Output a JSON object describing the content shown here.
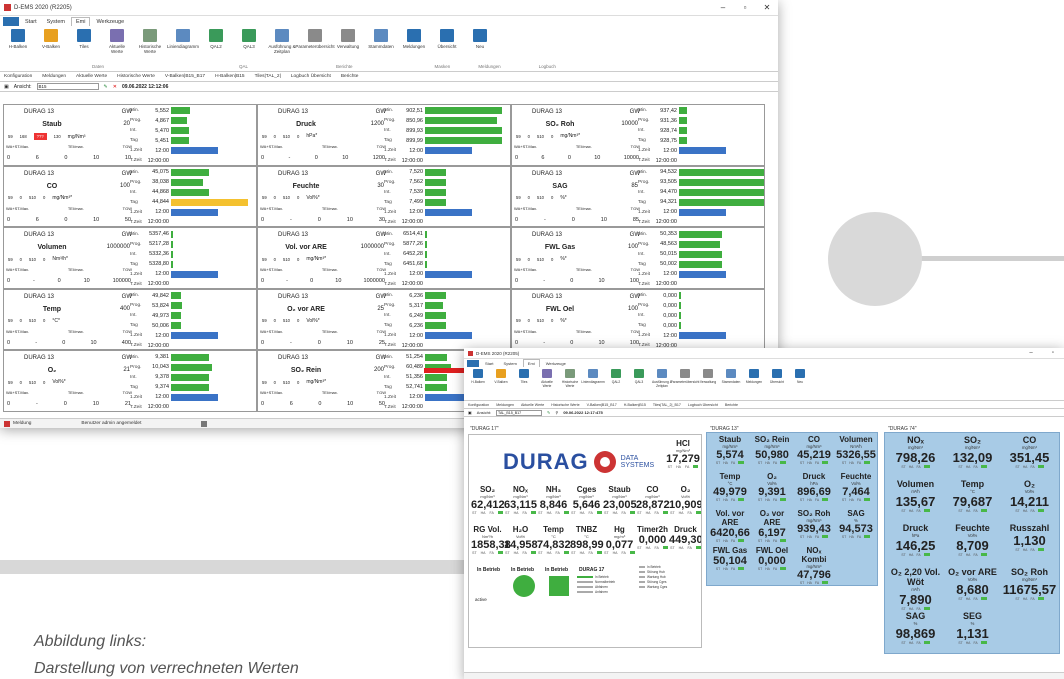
{
  "caption": {
    "line1": "Abbildung links:",
    "line2": "Darstellung von verrechneten Werten"
  },
  "colors": {
    "accent": "#2a6fb0",
    "bar_green": "#3fae3f",
    "bar_blue": "#3a73c6",
    "bar_yellow": "#f4c12f",
    "alarm_red": "#e33333",
    "tile_blue": "#a8cbe6",
    "arrow_red": "#e02020"
  },
  "w1": {
    "title": "D-EMS 2020 (R2205)",
    "menu": [
      "Start",
      "System",
      "Emi",
      "Werkzeuge"
    ],
    "menu_file": "",
    "ribbon": [
      {
        "label": "H-Balken",
        "icon": "h-bars-icon",
        "color": "#2a6fb0"
      },
      {
        "label": "V-Balken",
        "icon": "v-bars-icon",
        "color": "#e8a020"
      },
      {
        "label": "Tiles",
        "icon": "tiles-icon",
        "color": "#2a6fb0"
      },
      {
        "label": "Aktuelle Werte",
        "icon": "current-values-icon",
        "color": "#7a6fb0"
      },
      {
        "label": "Historische Werte",
        "icon": "historic-values-icon",
        "color": "#7a9a7a"
      },
      {
        "label": "Liniendiagramm",
        "icon": "line-chart-icon",
        "color": "#5c8ac0"
      },
      {
        "label": "QAL2",
        "icon": "qal2-icon",
        "color": "#3a9a5a"
      },
      {
        "label": "QAL3",
        "icon": "qal3-icon",
        "color": "#3a9a5a"
      },
      {
        "label": "Ausführung & Zeitplan",
        "icon": "schedule-icon",
        "color": "#5c8ac0"
      },
      {
        "label": "Parameterübersicht",
        "icon": "parameter-icon",
        "color": "#8a8a8a"
      },
      {
        "label": "Verwaltung",
        "icon": "admin-icon",
        "color": "#8a8a8a"
      },
      {
        "label": "Stammdaten",
        "icon": "master-data-icon",
        "color": "#5c8ac0"
      },
      {
        "label": "Meldungen",
        "icon": "globe-icon",
        "color": "#2a6fb0"
      },
      {
        "label": "Übersicht",
        "icon": "save-icon",
        "color": "#2a6fb0"
      },
      {
        "label": "Neu",
        "icon": "new-icon",
        "color": "#2a6fb0"
      }
    ],
    "groups": [
      "Daten",
      "QAL",
      "Berichte",
      "Masken",
      "Meldungen",
      "Logbuch"
    ],
    "tabs": [
      "Konfiguration",
      "Meldungen",
      "Aktuelle Werte",
      "Historische Werte",
      "V-Balken|B15_B17",
      "H-Balken|B15",
      "Tiles|TAL_2|",
      "Logbuch Übersicht",
      "Berichte"
    ],
    "view_label": "Ansicht:",
    "view_value": "B15",
    "timestamp": "09.06.2022 12:12:06",
    "status_left": "Meldung",
    "status_mid": "Benutzer admin angemeldet",
    "row_keys": [
      "Min.",
      "Prog.",
      "Int.",
      "Tag",
      "1.Zeit",
      "T.Zeit"
    ],
    "cells": [
      {
        "device": "DURAG 13",
        "gw_label": "GW",
        "name": "Staub",
        "gw": "20",
        "r3": [
          "59",
          "168",
          "???",
          "130",
          "mg/Nm³"
        ],
        "alarm": true,
        "r4": [
          "WA+ST.Max.",
          "TEI/max.",
          "TGW"
        ],
        "r5": [
          "0",
          "6",
          "0",
          "10",
          "10"
        ],
        "rvals": [
          "5,552",
          "4,867",
          "5,470",
          "5,451",
          "12:00",
          "12:00:00"
        ],
        "fills": [
          0.22,
          0.19,
          0.21,
          0.21,
          0,
          0
        ],
        "types": [
          "g",
          "g",
          "g",
          "g",
          "b",
          ""
        ]
      },
      {
        "device": "DURAG 13",
        "gw_label": "GW",
        "name": "Druck",
        "gw": "1200",
        "r3": [
          "59",
          "0",
          "510",
          "0",
          "hPa*"
        ],
        "alarm": false,
        "r4": [
          "WA+ST.Max.",
          "TEI/max.",
          "TGW"
        ],
        "r5": [
          "0",
          "-",
          "0",
          "10",
          "1200"
        ],
        "rvals": [
          "902,51",
          "850,96",
          "899,93",
          "899,99",
          "12:00",
          "12:00:00"
        ],
        "fills": [
          0.9,
          0.85,
          0.9,
          0.9,
          0,
          0
        ],
        "types": [
          "g",
          "g",
          "g",
          "g",
          "b",
          ""
        ]
      },
      {
        "device": "DURAG 13",
        "gw_label": "GW",
        "name": "SO₂ Roh",
        "gw": "10000",
        "r3": [
          "59",
          "0",
          "510",
          "0",
          "mg/Nm³*"
        ],
        "alarm": false,
        "r4": [
          "WA+ST.Max.",
          "TEI/max.",
          "TGW"
        ],
        "r5": [
          "0",
          "6",
          "0",
          "10",
          "10000"
        ],
        "rvals": [
          "937,42",
          "931,36",
          "928,74",
          "928,75",
          "12:00",
          "12:00:00"
        ],
        "fills": [
          0.09,
          0.09,
          0.09,
          0.09,
          0,
          0
        ],
        "types": [
          "g",
          "g",
          "g",
          "g",
          "b",
          ""
        ]
      },
      {
        "device": "DURAG 13",
        "gw_label": "GW",
        "name": "CO",
        "gw": "100",
        "r3": [
          "59",
          "0",
          "510",
          "0",
          "mg/Nm³*"
        ],
        "alarm": false,
        "r4": [
          "WA+ST.Max.",
          "TEI/max.",
          "TGW"
        ],
        "r5": [
          "0",
          "6",
          "0",
          "10",
          "50"
        ],
        "rvals": [
          "45,075",
          "38,038",
          "44,868",
          "44,844",
          "12:00",
          "12:00:00"
        ],
        "fills": [
          0.45,
          0.38,
          0.45,
          0.9,
          0,
          0
        ],
        "types": [
          "g",
          "g",
          "g",
          "y",
          "b",
          ""
        ]
      },
      {
        "device": "DURAG 13",
        "gw_label": "GW",
        "name": "Feuchte",
        "gw": "30",
        "r3": [
          "59",
          "0",
          "510",
          "0",
          "Vol%*"
        ],
        "alarm": false,
        "r4": [
          "WA+ST.Max.",
          "TEI/max.",
          "TGW"
        ],
        "r5": [
          "0",
          "-",
          "0",
          "10",
          "30"
        ],
        "rvals": [
          "7,520",
          "7,562",
          "7,539",
          "7,499",
          "12:00",
          "12:00:00"
        ],
        "fills": [
          0.25,
          0.25,
          0.25,
          0.25,
          0,
          0
        ],
        "types": [
          "g",
          "g",
          "g",
          "g",
          "b",
          ""
        ]
      },
      {
        "device": "DURAG 13",
        "gw_label": "GW",
        "name": "SAG",
        "gw": "85",
        "r3": [
          "59",
          "0",
          "510",
          "0",
          "%*"
        ],
        "alarm": false,
        "r4": [
          "WA+ST.Max.",
          "TEI/max.",
          "TGW"
        ],
        "r5": [
          "0",
          "-",
          "0",
          "10",
          "85"
        ],
        "rvals": [
          "94,532",
          "93,505",
          "94,470",
          "94,321",
          "12:00",
          "12:00:00"
        ],
        "fills": [
          1,
          1,
          1,
          1,
          0,
          0
        ],
        "types": [
          "g",
          "g",
          "g",
          "g",
          "b",
          ""
        ]
      },
      {
        "device": "DURAG 13",
        "gw_label": "GW",
        "name": "Volumen",
        "gw": "1000000",
        "r3": [
          "59",
          "0",
          "510",
          "0",
          "Nm³/h*"
        ],
        "alarm": false,
        "r4": [
          "WA+ST.Max.",
          "TEI/max.",
          "TGW"
        ],
        "r5": [
          "0",
          "-",
          "0",
          "10",
          "100000"
        ],
        "rvals": [
          "5357,46",
          "5217,28",
          "5332,36",
          "5328,80",
          "12:00",
          "12:00:00"
        ],
        "fills": [
          0.02,
          0.02,
          0.02,
          0.02,
          0,
          0
        ],
        "types": [
          "g",
          "g",
          "g",
          "g",
          "b",
          ""
        ]
      },
      {
        "device": "DURAG 13",
        "gw_label": "GW",
        "name": "Vol. vor ARE",
        "gw": "1000000",
        "r3": [
          "59",
          "0",
          "510",
          "0",
          "mg/Nm³*"
        ],
        "alarm": false,
        "r4": [
          "WA+ST.Max.",
          "TEI/max.",
          "TGW"
        ],
        "r5": [
          "0",
          "-",
          "0",
          "10",
          "1000000"
        ],
        "rvals": [
          "6514,41",
          "5877,26",
          "6452,28",
          "6451,68",
          "12:00",
          "12:00:00"
        ],
        "fills": [
          0,
          0,
          0,
          0,
          0,
          0
        ],
        "types": [
          "g",
          "g",
          "g",
          "g",
          "b",
          ""
        ]
      },
      {
        "device": "DURAG 13",
        "gw_label": "GW",
        "name": "FWL Gas",
        "gw": "100",
        "r3": [
          "59",
          "0",
          "510",
          "0",
          "%*"
        ],
        "alarm": false,
        "r4": [
          "WA+ST.Max.",
          "TEI/max.",
          "TGW"
        ],
        "r5": [
          "0",
          "-",
          "0",
          "10",
          "100"
        ],
        "rvals": [
          "50,353",
          "48,563",
          "50,015",
          "50,002",
          "12:00",
          "12:00:00"
        ],
        "fills": [
          0.5,
          0.48,
          0.5,
          0.5,
          0,
          0
        ],
        "types": [
          "g",
          "g",
          "g",
          "g",
          "b",
          ""
        ]
      },
      {
        "device": "DURAG 13",
        "gw_label": "GW",
        "name": "Temp",
        "gw": "400",
        "r3": [
          "59",
          "0",
          "510",
          "0",
          "°C*"
        ],
        "alarm": false,
        "r4": [
          "WA+ST.Max.",
          "TEI/max.",
          "TGW"
        ],
        "r5": [
          "0",
          "-",
          "0",
          "10",
          "400"
        ],
        "rvals": [
          "49,842",
          "53,824",
          "49,973",
          "50,006",
          "12:00",
          "12:00:00"
        ],
        "fills": [
          0.12,
          0.13,
          0.12,
          0.12,
          0,
          0
        ],
        "types": [
          "g",
          "g",
          "g",
          "g",
          "b",
          ""
        ]
      },
      {
        "device": "DURAG 13",
        "gw_label": "GW",
        "name": "O₂ vor ARE",
        "gw": "25",
        "r3": [
          "59",
          "0",
          "510",
          "0",
          "Vol%*"
        ],
        "alarm": false,
        "r4": [
          "WA+ST.Max.",
          "TEI/max.",
          "TGW"
        ],
        "r5": [
          "0",
          "-",
          "0",
          "10",
          "25"
        ],
        "rvals": [
          "6,236",
          "5,317",
          "6,249",
          "6,236",
          "12:00",
          "12:00:00"
        ],
        "fills": [
          0.25,
          0.21,
          0.25,
          0.25,
          0,
          0
        ],
        "types": [
          "g",
          "g",
          "g",
          "g",
          "b",
          ""
        ]
      },
      {
        "device": "DURAG 13",
        "gw_label": "GW",
        "name": "FWL Oel",
        "gw": "100",
        "r3": [
          "59",
          "0",
          "510",
          "0",
          "%*"
        ],
        "alarm": false,
        "r4": [
          "WA+ST.Max.",
          "TEI/max.",
          "TGW"
        ],
        "r5": [
          "0",
          "-",
          "0",
          "10",
          "100"
        ],
        "rvals": [
          "0,000",
          "0,000",
          "0,000",
          "0,000",
          "12:00",
          "12:00:00"
        ],
        "fills": [
          0,
          0,
          0,
          0,
          0,
          0
        ],
        "types": [
          "g",
          "g",
          "g",
          "g",
          "b",
          ""
        ]
      },
      {
        "device": "DURAG 13",
        "gw_label": "GW",
        "name": "O₂",
        "gw": "21",
        "r3": [
          "59",
          "0",
          "510",
          "0",
          "Vol%*"
        ],
        "alarm": false,
        "r4": [
          "WA+ST.Max.",
          "TEI/max.",
          "TGW"
        ],
        "r5": [
          "0",
          "-",
          "0",
          "10",
          "21"
        ],
        "rvals": [
          "9,381",
          "10,043",
          "9,378",
          "9,374",
          "12:00",
          "12:00:00"
        ],
        "fills": [
          0.45,
          0.48,
          0.45,
          0.45,
          0,
          0
        ],
        "types": [
          "g",
          "g",
          "g",
          "g",
          "b",
          ""
        ]
      },
      {
        "device": "DURAG 13",
        "gw_label": "GW",
        "name": "SO₂ Rein",
        "gw": "200",
        "r3": [
          "59",
          "0",
          "510",
          "0",
          "mg/Nm³*"
        ],
        "alarm": false,
        "r4": [
          "WA+ST.Max.",
          "TEI/max.",
          "TGW"
        ],
        "r5": [
          "0",
          "6",
          "0",
          "10",
          "50"
        ],
        "rvals": [
          "51,254",
          "60,489",
          "51,356",
          "52,741",
          "12:00",
          "12:00:00"
        ],
        "fills": [
          0.26,
          0.3,
          0.26,
          0.26,
          0,
          0
        ],
        "types": [
          "g",
          "g",
          "g",
          "g",
          "b",
          ""
        ]
      },
      {
        "device": "",
        "gw_label": "",
        "name": "",
        "gw": "",
        "r3": [
          "",
          "",
          "",
          "",
          ""
        ],
        "alarm": false,
        "r4": [
          "",
          "",
          ""
        ],
        "r5": [
          "",
          "",
          "",
          "",
          ""
        ],
        "rvals": [
          "",
          "",
          "",
          "",
          "",
          ""
        ],
        "fills": [
          0,
          0,
          0,
          0,
          0,
          0
        ],
        "types": [
          "",
          "",
          "",
          "",
          "",
          ""
        ]
      }
    ]
  },
  "w2": {
    "title": "D-EMS 2020 (R2205)",
    "menu": [
      "Start",
      "System",
      "Emi",
      "Werkzeuge"
    ],
    "tabs": [
      "Konfiguration",
      "Meldungen",
      "Aktuelle Werte",
      "Historische Werte",
      "V-Balken|B15_B17",
      "H-Balken|B15",
      "Tiles|TAL_2|_B17",
      "Logbuch Übersicht",
      "Berichte"
    ],
    "view_label": "Ansicht:",
    "view_value": "TAL_B15_B17",
    "timestamp": "09.06.2022 12:17:475",
    "panel_left": "\"DURAG 17\"",
    "panel_mid": "\"DURAG 13\"",
    "panel_right": "\"DURAG 74\"",
    "logo_main": "DURAG",
    "logo_sub1": "DATA",
    "logo_sub2": "SYSTEMS",
    "hcl": {
      "n": "HCl",
      "u": "mg/Nm³",
      "v": "17,279"
    },
    "row1": [
      {
        "n": "SO₂",
        "u": "mg/Nm³",
        "v": "62,412"
      },
      {
        "n": "NOₓ",
        "u": "mg/Nm³",
        "v": "63,115"
      },
      {
        "n": "NH₃",
        "u": "mg/Nm³",
        "v": "8,846"
      },
      {
        "n": "Cges",
        "u": "mg/Nm³",
        "v": "5,646"
      },
      {
        "n": "Staub",
        "u": "mg/Nm³",
        "v": "23,005"
      },
      {
        "n": "CO",
        "u": "mg/Nm³",
        "v": "28,872"
      },
      {
        "n": "O₂",
        "u": "Vol%",
        "v": "10,909"
      }
    ],
    "row2": [
      {
        "n": "RG Vol.",
        "u": "Nm³/h",
        "v": "1858,38"
      },
      {
        "n": "H₂O",
        "u": "Vol%",
        "v": "14,958"
      },
      {
        "n": "Temp",
        "u": "°C",
        "v": "74,832"
      },
      {
        "n": "TNBZ",
        "u": "°C",
        "v": "898,99"
      },
      {
        "n": "Hg",
        "u": "mg/m³",
        "v": "0,077"
      },
      {
        "n": "Timer2h",
        "u": "",
        "v": "0,000"
      },
      {
        "n": "Druck",
        "u": "",
        "v": "449,30"
      }
    ],
    "status_row": {
      "a": "In Betrieb",
      "b": "In Betrieb",
      "c": "In Betrieb",
      "d": "DURAG 17",
      "e": "active"
    },
    "legend": [
      "In Betrieb",
      "Normalbetrieb",
      "Abfahren",
      "Anfahren"
    ],
    "legend2": [
      "In Betrieb",
      "Störung Hub",
      "Wartung Hub",
      "Störung Cges",
      "Wartung Cges"
    ],
    "mid_tiles": [
      {
        "n": "Staub",
        "u": "mg/Nm³",
        "v": "5,574"
      },
      {
        "n": "SO₂ Rein",
        "u": "mg/Nm³",
        "v": "50,980"
      },
      {
        "n": "CO",
        "u": "mg/Nm³",
        "v": "45,219"
      },
      {
        "n": "Volumen",
        "u": "Nm³/h",
        "v": "5326,55"
      },
      {
        "n": "Temp",
        "u": "°C",
        "v": "49,979"
      },
      {
        "n": "O₂",
        "u": "Vol%",
        "v": "9,391"
      },
      {
        "n": "Druck",
        "u": "hPa",
        "v": "896,69"
      },
      {
        "n": "Feuchte",
        "u": "Vol%",
        "v": "7,464"
      },
      {
        "n": "Vol. vor ARE",
        "u": "",
        "v": "6420,66"
      },
      {
        "n": "O₂ vor ARE",
        "u": "",
        "v": "6,197"
      },
      {
        "n": "SO₂ Roh",
        "u": "mg/Nm³",
        "v": "939,43"
      },
      {
        "n": "SAG",
        "u": "%",
        "v": "94,573"
      },
      {
        "n": "FWL Gas",
        "u": "",
        "v": "50,104"
      },
      {
        "n": "FWL Oel",
        "u": "",
        "v": "0,000"
      },
      {
        "n": "NOₓ Kombi",
        "u": "mg/Nm³",
        "v": "47,796"
      }
    ],
    "right_tiles": [
      {
        "n": "NOₓ",
        "u": "mg/Nm³",
        "v": "798,26"
      },
      {
        "n": "SO₂",
        "u": "mg/Nm³",
        "v": "132,09"
      },
      {
        "n": "CO",
        "u": "mg/Nm³",
        "v": "351,45"
      },
      {
        "n": "Volumen",
        "u": "m³/h",
        "v": "135,67"
      },
      {
        "n": "Temp",
        "u": "°C",
        "v": "79,687"
      },
      {
        "n": "O₂",
        "u": "Vol%",
        "v": "14,211"
      },
      {
        "n": "Druck",
        "u": "hPa",
        "v": "146,25"
      },
      {
        "n": "Feuchte",
        "u": "Vol%",
        "v": "8,709"
      },
      {
        "n": "Russzahl",
        "u": "",
        "v": "1,130"
      },
      {
        "n": "O₂ 2,20 Vol. Wöt",
        "u": "m³/h",
        "v": "7,890"
      },
      {
        "n": "O₂ vor ARE",
        "u": "Vol%",
        "v": "8,680"
      },
      {
        "n": "SO₂ Roh",
        "u": "mg/Nm³",
        "v": "11675,57"
      },
      {
        "n": "SAG",
        "u": "%",
        "v": "98,869"
      },
      {
        "n": "SEG",
        "u": "%",
        "v": "1,131"
      }
    ],
    "tile_stamp": [
      "ST",
      "HA",
      "FA"
    ]
  }
}
